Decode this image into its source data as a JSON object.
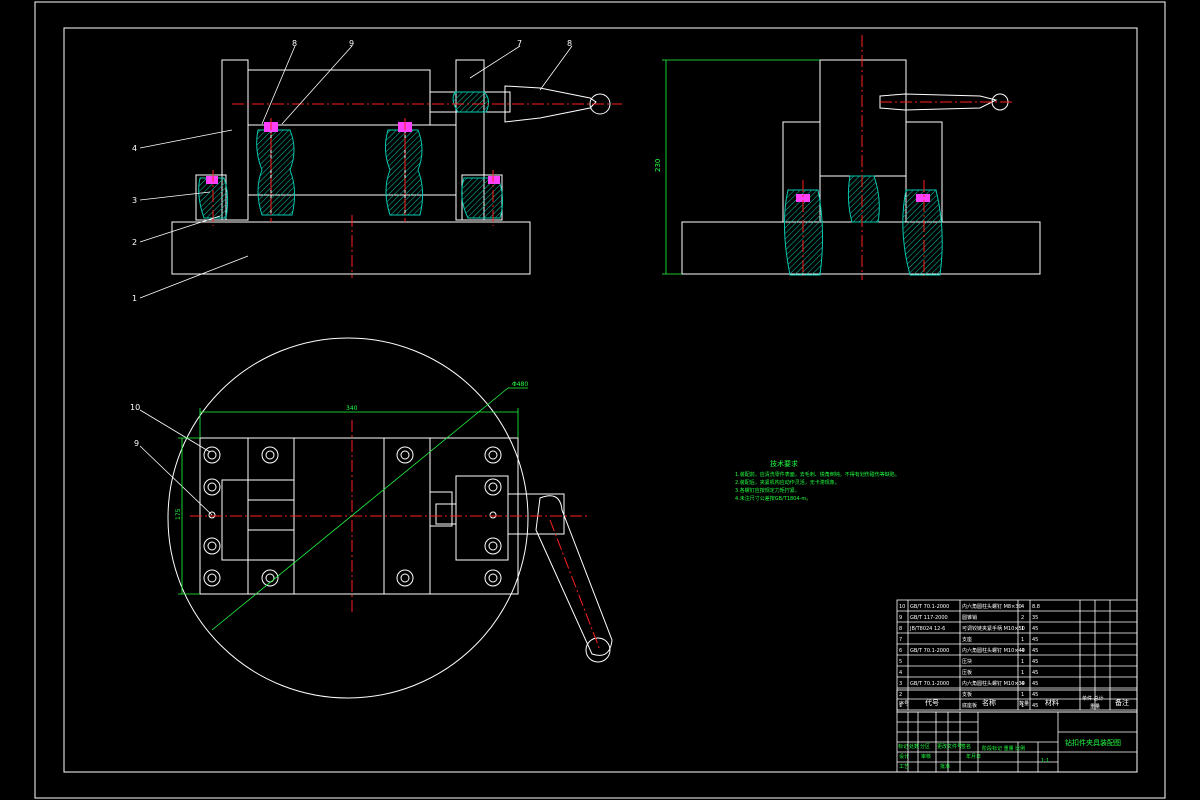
{
  "drawing": {
    "balloon_labels": [
      "1",
      "2",
      "3",
      "4",
      "8",
      "9",
      "7",
      "8",
      "10",
      "9"
    ],
    "dim_height": "230",
    "dim_length": "340",
    "dim_width": "175",
    "dim_diameter": "Φ480",
    "tech_req_title": "技术要求",
    "tech_req_lines": [
      "1.装配前，应清洗零件表面，去毛刺、锐角倒钝，不得有划伤碰伤等缺陷。",
      "2.装配后，夹紧机构应动作灵活，无卡滞现象。",
      "3.各螺钉应按规定力矩拧紧。",
      "4.未注尺寸公差按GB/T1804-m。"
    ]
  },
  "bom": {
    "rows": [
      {
        "no": "10",
        "code": "GB/T 70.1-2000",
        "name": "内六角圆柱头螺钉 M8×30",
        "qty": "4",
        "material": "8.8"
      },
      {
        "no": "9",
        "code": "GB/T 117-2000",
        "name": "圆锥销",
        "qty": "2",
        "material": "35"
      },
      {
        "no": "8",
        "code": "JB/T8024 12-6",
        "name": "可调铰链夹紧手柄 M10×50",
        "qty": "1",
        "material": "45"
      },
      {
        "no": "7",
        "code": "",
        "name": "支座",
        "qty": "1",
        "material": "45"
      },
      {
        "no": "6",
        "code": "GB/T 70.1-2000",
        "name": "内六角圆柱头螺钉 M10×40",
        "qty": "4",
        "material": "45"
      },
      {
        "no": "5",
        "code": "",
        "name": "压块",
        "qty": "1",
        "material": "45"
      },
      {
        "no": "4",
        "code": "",
        "name": "压板",
        "qty": "1",
        "material": "45"
      },
      {
        "no": "3",
        "code": "GB/T 70.1-2000",
        "name": "内六角圆柱头螺钉 M10×30",
        "qty": "4",
        "material": "45"
      },
      {
        "no": "2",
        "code": "",
        "name": "支板",
        "qty": "1",
        "material": "45"
      },
      {
        "no": "1",
        "code": "",
        "name": "底座板",
        "qty": "1",
        "material": "45"
      }
    ],
    "header_no": "序号",
    "header_code": "代号",
    "header_name": "名称",
    "header_qty": "数量",
    "header_material": "材料",
    "header_weight": "单件 总计",
    "header_weight2": "重量",
    "header_remark": "备注"
  },
  "title_block": {
    "title": "钻扣件夹具装配图",
    "scale": "1:1",
    "marks": [
      "标记",
      "处数",
      "分区",
      "更改文件号",
      "签名",
      "年月日"
    ],
    "roles": [
      "设计",
      "审核",
      "工艺",
      "批准"
    ],
    "stage": "阶段标记 重量 比例"
  },
  "colors": {
    "outline": "#ffffff",
    "centerline": "#ff2020",
    "dimension": "#20ff40",
    "section": "#00e0c0",
    "bolt": "#ff40ff"
  }
}
